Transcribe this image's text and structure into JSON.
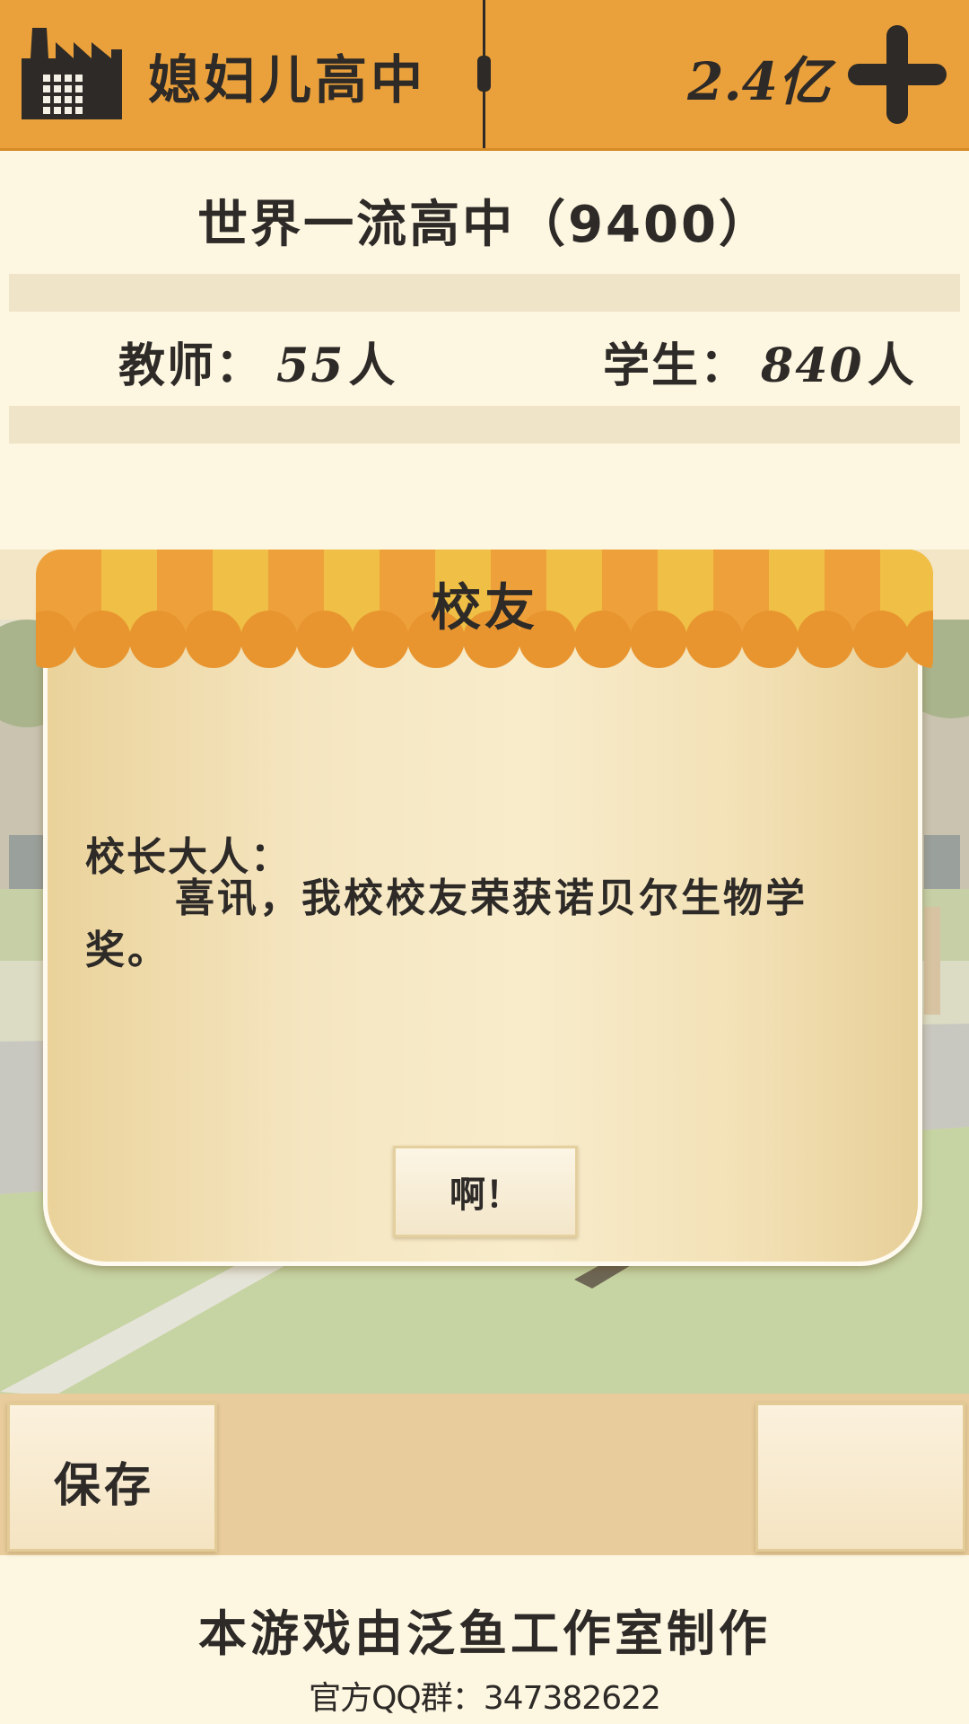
{
  "header": {
    "school_name": "媳妇儿高中",
    "money": "2.4亿",
    "icons": {
      "school": "factory-building-icon",
      "add": "plus-icon"
    }
  },
  "info": {
    "rank": "世界一流高中（9400）",
    "teachers_label": "教师：",
    "teachers_count": "55",
    "teachers_unit": "人",
    "students_label": "学生：",
    "students_count": "840",
    "students_unit": "人"
  },
  "dialog": {
    "title": "校友",
    "greeting": "校长大人：",
    "body": "喜讯，我校校友荣获诺贝尔生物学奖。",
    "ok_label": "啊！"
  },
  "actions": {
    "save_label": "保存"
  },
  "footer": {
    "credit": "本游戏由泛鱼工作室制作",
    "qq": "官方QQ群：347382622"
  },
  "colors": {
    "topbar": "#eba13b",
    "panel": "#fdf6e1",
    "text": "#2d2a27",
    "dialog": "#f5e6c1",
    "actionbar": "#e8cc9b"
  }
}
